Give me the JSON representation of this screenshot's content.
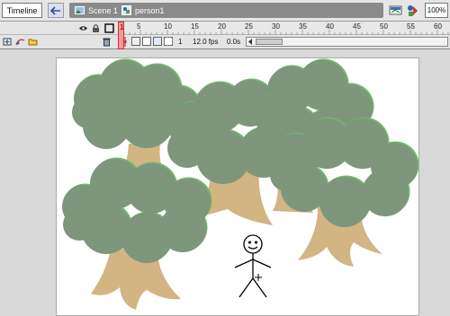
{
  "editbar": {
    "timeline_label": "Timeline",
    "back_icon": "back-arrow-icon",
    "breadcrumb": {
      "scene_label": "Scene 1",
      "symbol_label": "person1"
    },
    "zoom_value": "100%"
  },
  "timeline": {
    "ruler_ticks": [
      "5",
      "10",
      "15",
      "20",
      "25",
      "30",
      "35",
      "40",
      "45",
      "50",
      "55",
      "60"
    ],
    "current_frame": "1",
    "playhead_label": "1",
    "frame_rate": "12.0 fps",
    "elapsed_time": "0.0s"
  },
  "colors": {
    "foliage": "#7d967c",
    "foliage_edge": "#6fb86a",
    "trunk": "#d2b583",
    "stage": "#ffffff",
    "workspace": "#d8d8d8"
  }
}
